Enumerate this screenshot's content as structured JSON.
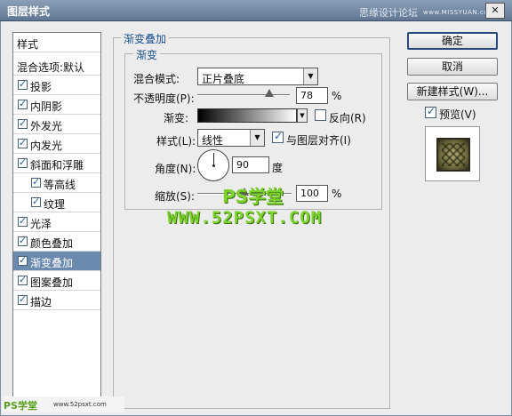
{
  "window": {
    "title": "图层样式",
    "close_label": "✕",
    "watermark": "思缘设计论坛",
    "watermark_url": "www.MISSYUAN.com"
  },
  "sidebar": {
    "header": "样式",
    "blend_options": "混合选项:默认",
    "items": [
      {
        "label": "投影",
        "checked": true
      },
      {
        "label": "内阴影",
        "checked": true
      },
      {
        "label": "外发光",
        "checked": true
      },
      {
        "label": "内发光",
        "checked": true
      },
      {
        "label": "斜面和浮雕",
        "checked": true
      },
      {
        "label": "等高线",
        "checked": true
      },
      {
        "label": "纹理",
        "checked": true
      },
      {
        "label": "光泽",
        "checked": true
      },
      {
        "label": "颜色叠加",
        "checked": true
      },
      {
        "label": "渐变叠加",
        "checked": true,
        "selected": true
      },
      {
        "label": "图案叠加",
        "checked": true
      },
      {
        "label": "描边",
        "checked": true
      }
    ]
  },
  "panel": {
    "group_title": "渐变叠加",
    "subgroup_title": "渐变",
    "blend_mode_label": "混合模式:",
    "blend_mode_value": "正片叠底",
    "opacity_label": "不透明度(P):",
    "opacity_value": "78",
    "percent": "%",
    "gradient_label": "渐变:",
    "reverse_label": "反向(R)",
    "reverse_checked": false,
    "style_label": "样式(L):",
    "style_value": "线性",
    "align_label": "与图层对齐(I)",
    "align_checked": true,
    "angle_label": "角度(N):",
    "angle_value": "90",
    "degree": "度",
    "scale_label": "缩放(S):",
    "scale_value": "100",
    "opacity_level": 0.78,
    "scale_level": 1.0
  },
  "watermarks": {
    "ps_logo": "PS学堂",
    "ps_url": "WWW.52PSXT.COM",
    "bottom_ps": "PS学堂",
    "bottom_url": "www.52psxt.com"
  },
  "buttons": {
    "ok": "确定",
    "cancel": "取消",
    "new_style": "新建样式(W)...",
    "preview_label": "预览(V)",
    "preview_checked": true
  }
}
